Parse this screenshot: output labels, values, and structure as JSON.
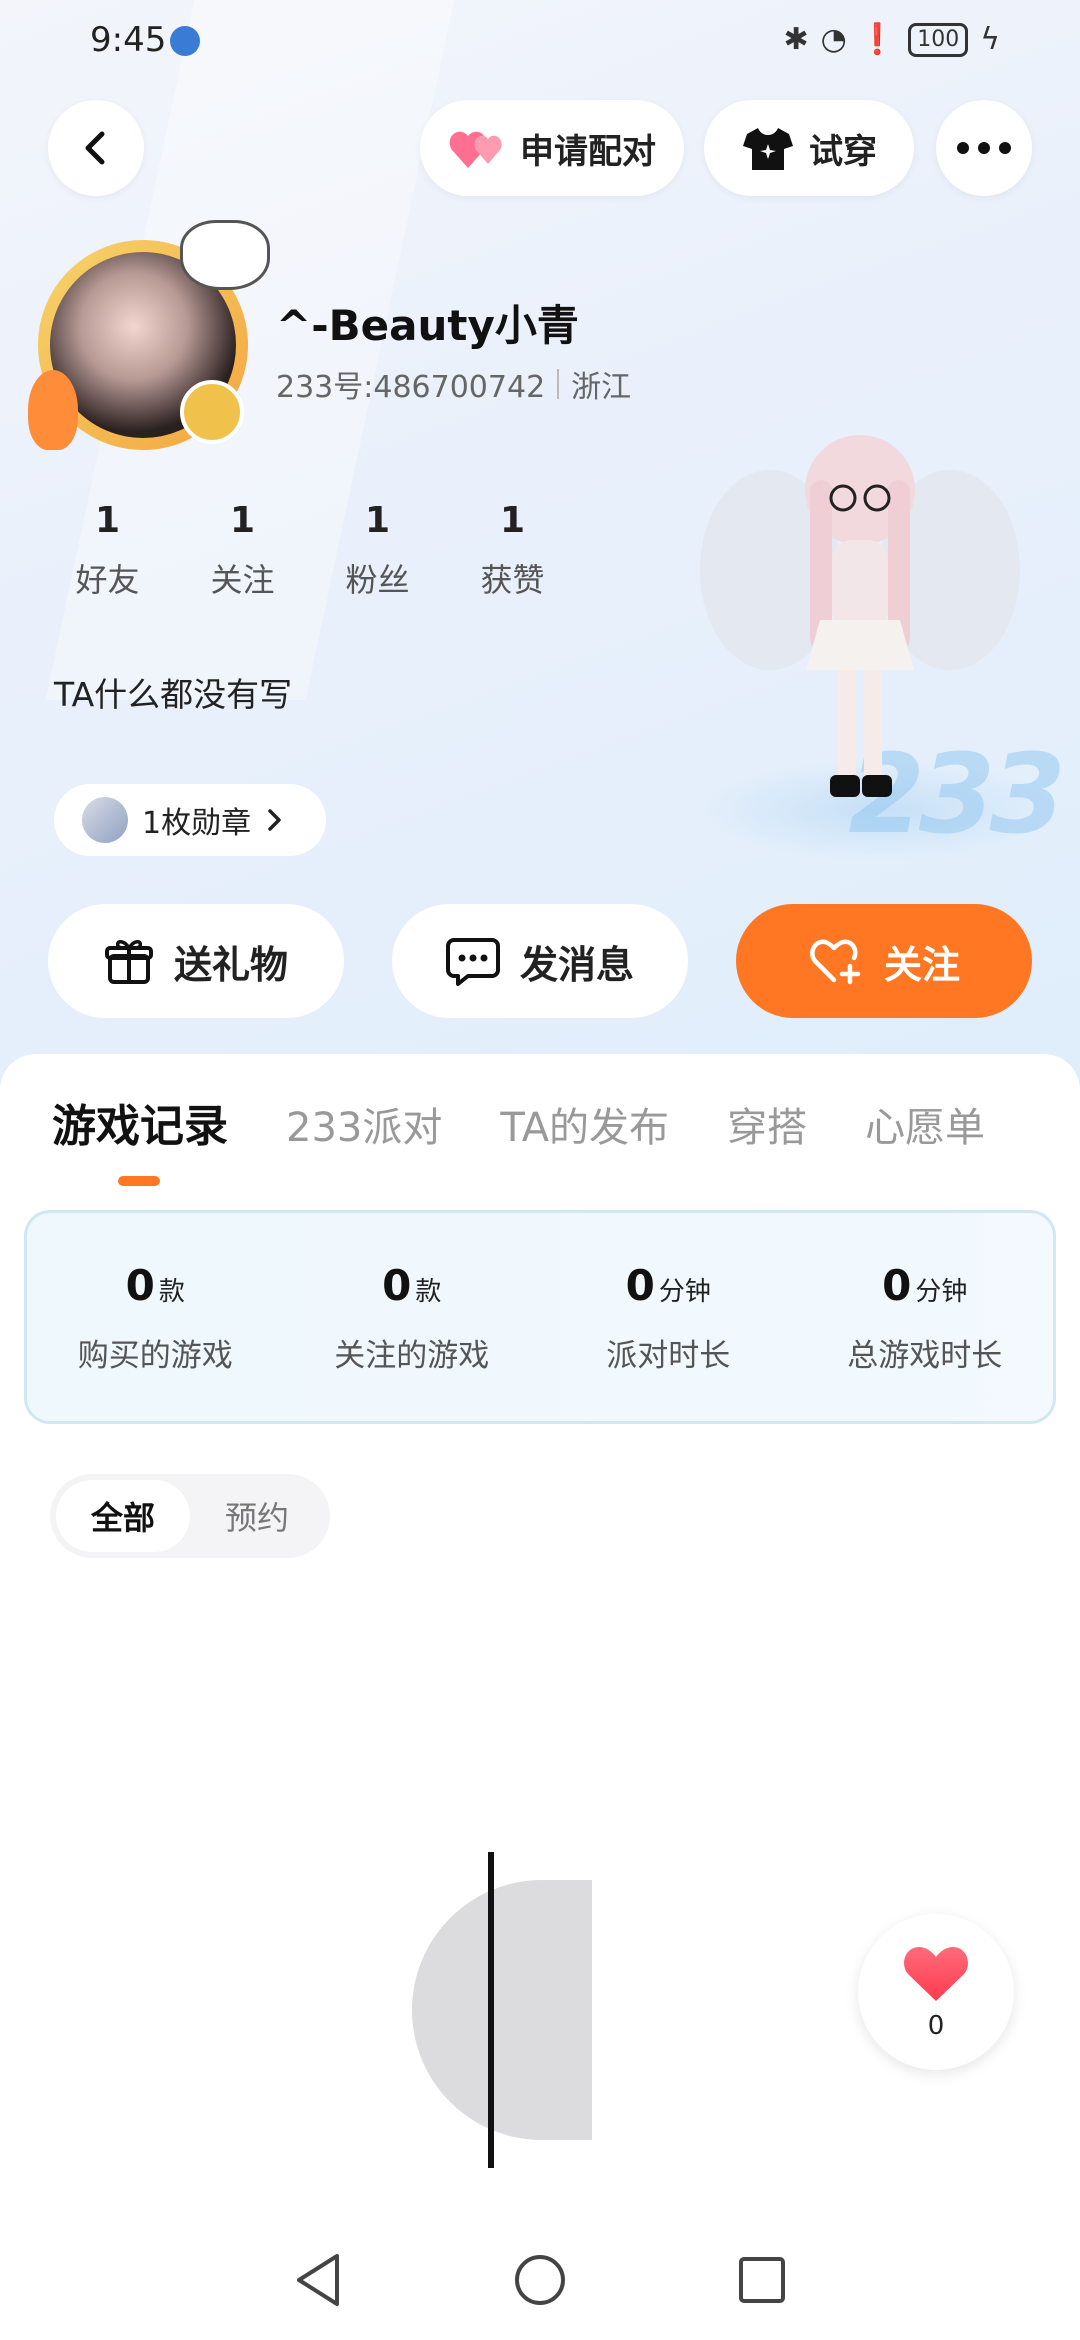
{
  "status_bar": {
    "time": "9:45",
    "battery": "100"
  },
  "header": {
    "pair_button": "申请配对",
    "try_on_button": "试穿"
  },
  "profile": {
    "username": "^-Beauty小青",
    "id_text": "233号:486700742",
    "location": "浙江",
    "stats": [
      {
        "value": "1",
        "label": "好友"
      },
      {
        "value": "1",
        "label": "关注"
      },
      {
        "value": "1",
        "label": "粉丝"
      },
      {
        "value": "1",
        "label": "获赞"
      }
    ],
    "bio": "TA什么都没有写",
    "badges_text": "1枚勋章",
    "decor_text": "233"
  },
  "actions": {
    "gift": "送礼物",
    "message": "发消息",
    "follow": "关注"
  },
  "tabs": [
    "游戏记录",
    "233派对",
    "TA的发布",
    "穿搭",
    "心愿单"
  ],
  "summary": [
    {
      "value": "0",
      "unit": "款",
      "label": "购买的游戏"
    },
    {
      "value": "0",
      "unit": "款",
      "label": "关注的游戏"
    },
    {
      "value": "0",
      "unit": "分钟",
      "label": "派对时长"
    },
    {
      "value": "0",
      "unit": "分钟",
      "label": "总游戏时长"
    }
  ],
  "filter": {
    "all": "全部",
    "reserved": "预约"
  },
  "like_float": {
    "count": "0"
  },
  "colors": {
    "accent": "#ff7722",
    "heart": "#ff4d6d"
  }
}
